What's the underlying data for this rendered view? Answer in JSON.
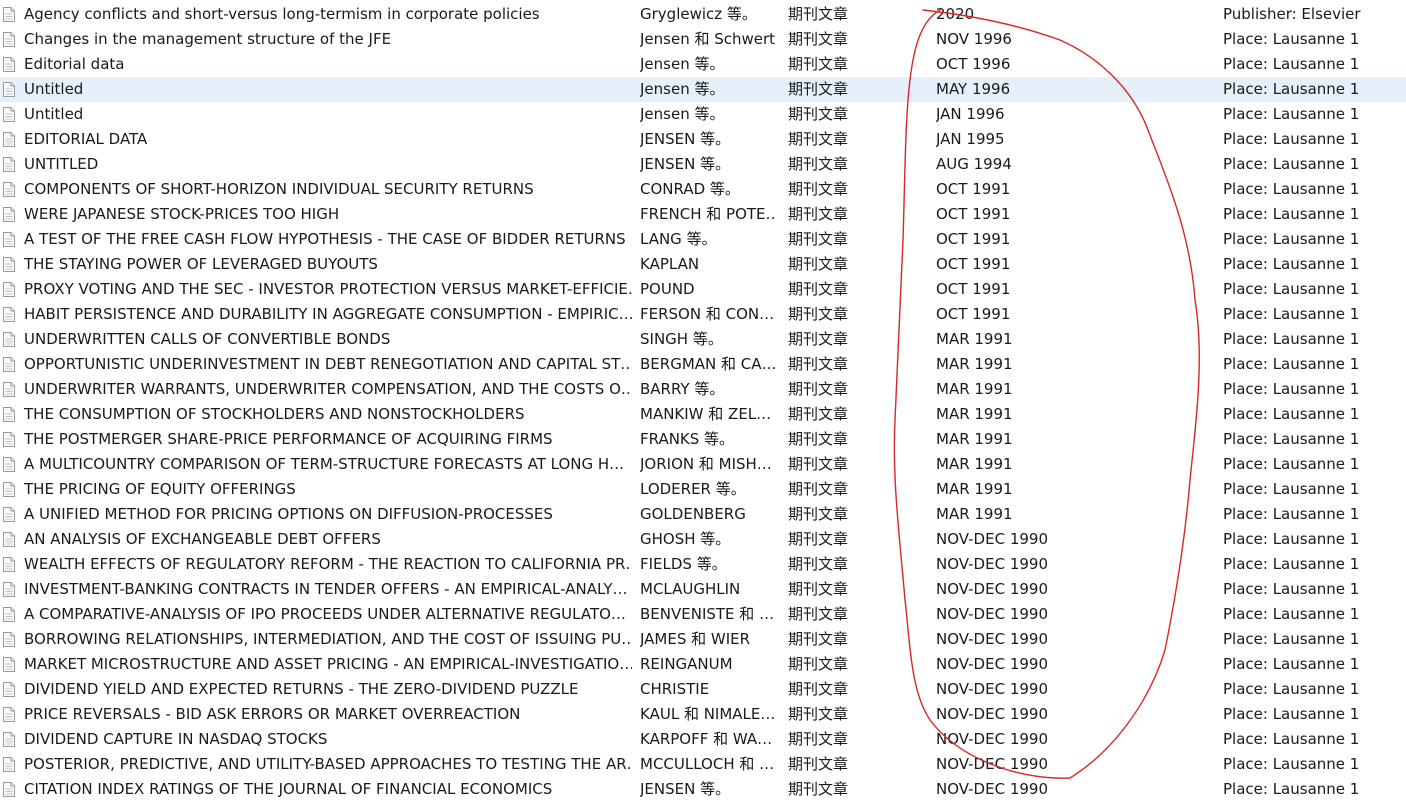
{
  "rows": [
    {
      "title": "Agency conflicts and short-versus long-termism in corporate policies",
      "author": "Gryglewicz 等。",
      "type": "期刊文章",
      "date": "2020",
      "extra": "Publisher: Elsevier"
    },
    {
      "title": "Changes in the management structure of the JFE",
      "author": "Jensen 和 Schwert",
      "type": "期刊文章",
      "date": "NOV 1996",
      "extra": "Place: Lausanne 1"
    },
    {
      "title": "Editorial data",
      "author": "Jensen 等。",
      "type": "期刊文章",
      "date": "OCT 1996",
      "extra": "Place: Lausanne 1"
    },
    {
      "title": "Untitled",
      "author": "Jensen 等。",
      "type": "期刊文章",
      "date": "MAY 1996",
      "extra": "Place: Lausanne 1"
    },
    {
      "title": "Untitled",
      "author": "Jensen 等。",
      "type": "期刊文章",
      "date": "JAN 1996",
      "extra": "Place: Lausanne 1"
    },
    {
      "title": "EDITORIAL DATA",
      "author": "JENSEN 等。",
      "type": "期刊文章",
      "date": "JAN 1995",
      "extra": "Place: Lausanne 1"
    },
    {
      "title": "UNTITLED",
      "author": "JENSEN 等。",
      "type": "期刊文章",
      "date": "AUG 1994",
      "extra": "Place: Lausanne 1"
    },
    {
      "title": "COMPONENTS OF SHORT-HORIZON INDIVIDUAL SECURITY RETURNS",
      "author": "CONRAD 等。",
      "type": "期刊文章",
      "date": "OCT 1991",
      "extra": "Place: Lausanne 1"
    },
    {
      "title": "WERE JAPANESE STOCK-PRICES TOO HIGH",
      "author": "FRENCH 和 POTE…",
      "type": "期刊文章",
      "date": "OCT 1991",
      "extra": "Place: Lausanne 1"
    },
    {
      "title": "A TEST OF THE FREE CASH FLOW HYPOTHESIS - THE CASE OF BIDDER RETURNS",
      "author": "LANG 等。",
      "type": "期刊文章",
      "date": "OCT 1991",
      "extra": "Place: Lausanne 1"
    },
    {
      "title": "THE STAYING POWER OF LEVERAGED BUYOUTS",
      "author": "KAPLAN",
      "type": "期刊文章",
      "date": "OCT 1991",
      "extra": "Place: Lausanne 1"
    },
    {
      "title": "PROXY VOTING AND THE SEC - INVESTOR PROTECTION VERSUS MARKET-EFFICIE…",
      "author": "POUND",
      "type": "期刊文章",
      "date": "OCT 1991",
      "extra": "Place: Lausanne 1"
    },
    {
      "title": "HABIT PERSISTENCE AND DURABILITY IN AGGREGATE CONSUMPTION - EMPIRIC…",
      "author": "FERSON 和 CON…",
      "type": "期刊文章",
      "date": "OCT 1991",
      "extra": "Place: Lausanne 1"
    },
    {
      "title": "UNDERWRITTEN CALLS OF CONVERTIBLE BONDS",
      "author": "SINGH 等。",
      "type": "期刊文章",
      "date": "MAR 1991",
      "extra": "Place: Lausanne 1"
    },
    {
      "title": "OPPORTUNISTIC UNDERINVESTMENT IN DEBT RENEGOTIATION AND CAPITAL ST…",
      "author": "BERGMAN 和 CA…",
      "type": "期刊文章",
      "date": "MAR 1991",
      "extra": "Place: Lausanne 1"
    },
    {
      "title": "UNDERWRITER WARRANTS, UNDERWRITER COMPENSATION, AND THE COSTS O…",
      "author": "BARRY 等。",
      "type": "期刊文章",
      "date": "MAR 1991",
      "extra": "Place: Lausanne 1"
    },
    {
      "title": "THE CONSUMPTION OF STOCKHOLDERS AND NONSTOCKHOLDERS",
      "author": "MANKIW 和 ZEL…",
      "type": "期刊文章",
      "date": "MAR 1991",
      "extra": "Place: Lausanne 1"
    },
    {
      "title": "THE POSTMERGER SHARE-PRICE PERFORMANCE OF ACQUIRING FIRMS",
      "author": "FRANKS 等。",
      "type": "期刊文章",
      "date": "MAR 1991",
      "extra": "Place: Lausanne 1"
    },
    {
      "title": "A MULTICOUNTRY COMPARISON OF TERM-STRUCTURE FORECASTS AT LONG H…",
      "author": "JORION 和 MISH…",
      "type": "期刊文章",
      "date": "MAR 1991",
      "extra": "Place: Lausanne 1"
    },
    {
      "title": "THE PRICING OF EQUITY OFFERINGS",
      "author": "LODERER 等。",
      "type": "期刊文章",
      "date": "MAR 1991",
      "extra": "Place: Lausanne 1"
    },
    {
      "title": "A UNIFIED METHOD FOR PRICING OPTIONS ON DIFFUSION-PROCESSES",
      "author": "GOLDENBERG",
      "type": "期刊文章",
      "date": "MAR 1991",
      "extra": "Place: Lausanne 1"
    },
    {
      "title": "AN ANALYSIS OF EXCHANGEABLE DEBT OFFERS",
      "author": "GHOSH 等。",
      "type": "期刊文章",
      "date": "NOV-DEC 1990",
      "extra": "Place: Lausanne 1"
    },
    {
      "title": "WEALTH EFFECTS OF REGULATORY REFORM - THE REACTION TO CALIFORNIA PR…",
      "author": "FIELDS 等。",
      "type": "期刊文章",
      "date": "NOV-DEC 1990",
      "extra": "Place: Lausanne 1"
    },
    {
      "title": "INVESTMENT-BANKING CONTRACTS IN TENDER OFFERS - AN EMPIRICAL-ANALY…",
      "author": "MCLAUGHLIN",
      "type": "期刊文章",
      "date": "NOV-DEC 1990",
      "extra": "Place: Lausanne 1"
    },
    {
      "title": "A COMPARATIVE-ANALYSIS OF IPO PROCEEDS UNDER ALTERNATIVE REGULATO…",
      "author": "BENVENISTE 和 …",
      "type": "期刊文章",
      "date": "NOV-DEC 1990",
      "extra": "Place: Lausanne 1"
    },
    {
      "title": "BORROWING RELATIONSHIPS, INTERMEDIATION, AND THE COST OF ISSUING PU…",
      "author": "JAMES 和 WIER",
      "type": "期刊文章",
      "date": "NOV-DEC 1990",
      "extra": "Place: Lausanne 1"
    },
    {
      "title": "MARKET MICROSTRUCTURE AND ASSET PRICING - AN EMPIRICAL-INVESTIGATIO…",
      "author": "REINGANUM",
      "type": "期刊文章",
      "date": "NOV-DEC 1990",
      "extra": "Place: Lausanne 1"
    },
    {
      "title": "DIVIDEND YIELD AND EXPECTED RETURNS - THE ZERO-DIVIDEND PUZZLE",
      "author": "CHRISTIE",
      "type": "期刊文章",
      "date": "NOV-DEC 1990",
      "extra": "Place: Lausanne 1"
    },
    {
      "title": "PRICE REVERSALS - BID ASK ERRORS OR MARKET OVERREACTION",
      "author": "KAUL 和 NIMALE…",
      "type": "期刊文章",
      "date": "NOV-DEC 1990",
      "extra": "Place: Lausanne 1"
    },
    {
      "title": "DIVIDEND CAPTURE IN NASDAQ STOCKS",
      "author": "KARPOFF 和 WA…",
      "type": "期刊文章",
      "date": "NOV-DEC 1990",
      "extra": "Place: Lausanne 1"
    },
    {
      "title": "POSTERIOR, PREDICTIVE, AND UTILITY-BASED APPROACHES TO TESTING THE AR…",
      "author": "MCCULLOCH 和 …",
      "type": "期刊文章",
      "date": "NOV-DEC 1990",
      "extra": "Place: Lausanne 1"
    },
    {
      "title": "CITATION INDEX RATINGS OF THE JOURNAL OF FINANCIAL ECONOMICS",
      "author": "JENSEN 等。",
      "type": "期刊文章",
      "date": "NOV-DEC 1990",
      "extra": "Place: Lausanne 1"
    }
  ],
  "selected_row": 3,
  "icon_name": "document-icon",
  "colors": {
    "selection": "#e6f0fa",
    "annotation": "#d62828",
    "text": "#1a1a1a"
  }
}
